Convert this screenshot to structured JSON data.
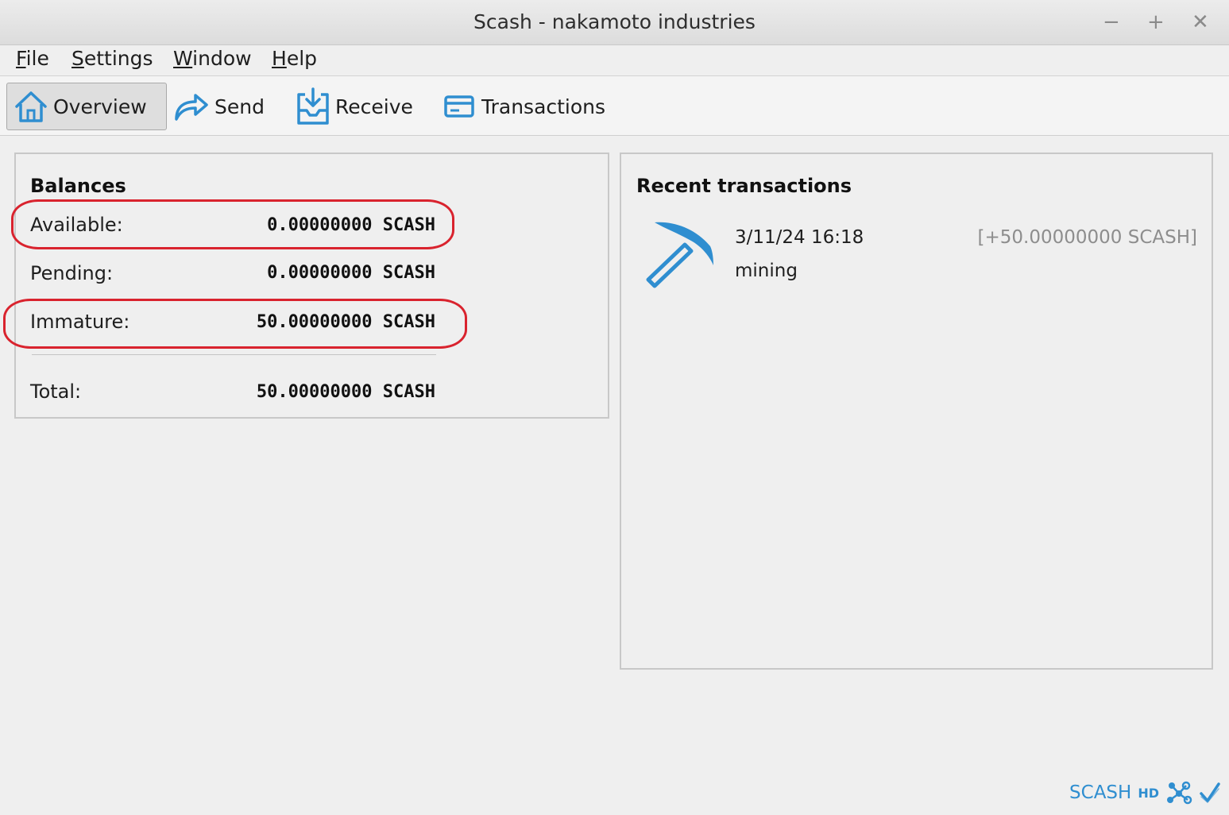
{
  "window": {
    "title": "Scash - nakamoto industries",
    "controls": {
      "minimize": "−",
      "maximize": "+",
      "close": "✕"
    }
  },
  "menu": {
    "items": [
      {
        "mnemonic": "F",
        "rest": "ile"
      },
      {
        "mnemonic": "S",
        "rest": "ettings"
      },
      {
        "mnemonic": "W",
        "rest": "indow"
      },
      {
        "mnemonic": "H",
        "rest": "elp"
      }
    ]
  },
  "toolbar": {
    "tabs": [
      {
        "label": "Overview",
        "icon": "home-icon",
        "active": true
      },
      {
        "label": "Send",
        "icon": "send-arrow-icon",
        "active": false
      },
      {
        "label": "Receive",
        "icon": "receive-inbox-icon",
        "active": false
      },
      {
        "label": "Transactions",
        "icon": "card-icon",
        "active": false
      }
    ]
  },
  "balances": {
    "heading": "Balances",
    "available": {
      "label": "Available:",
      "amount": "0.00000000 SCASH"
    },
    "pending": {
      "label": "Pending:",
      "amount": "0.00000000 SCASH"
    },
    "immature": {
      "label": "Immature:",
      "amount": "50.00000000 SCASH"
    },
    "total": {
      "label": "Total:",
      "amount": "50.00000000 SCASH"
    }
  },
  "recent": {
    "heading": "Recent transactions",
    "items": [
      {
        "date": "3/11/24 16:18",
        "amount": "[+50.00000000 SCASH]",
        "label": "mining",
        "icon": "pickaxe-icon"
      }
    ]
  },
  "status": {
    "unit": "SCASH",
    "hd": "HD",
    "icons": [
      "hd-key-icon",
      "network-icon",
      "synced-check-icon"
    ]
  },
  "colors": {
    "accent": "#2f8ed0",
    "highlight": "#d9232e",
    "muted_amount": "#8d8d8d"
  }
}
